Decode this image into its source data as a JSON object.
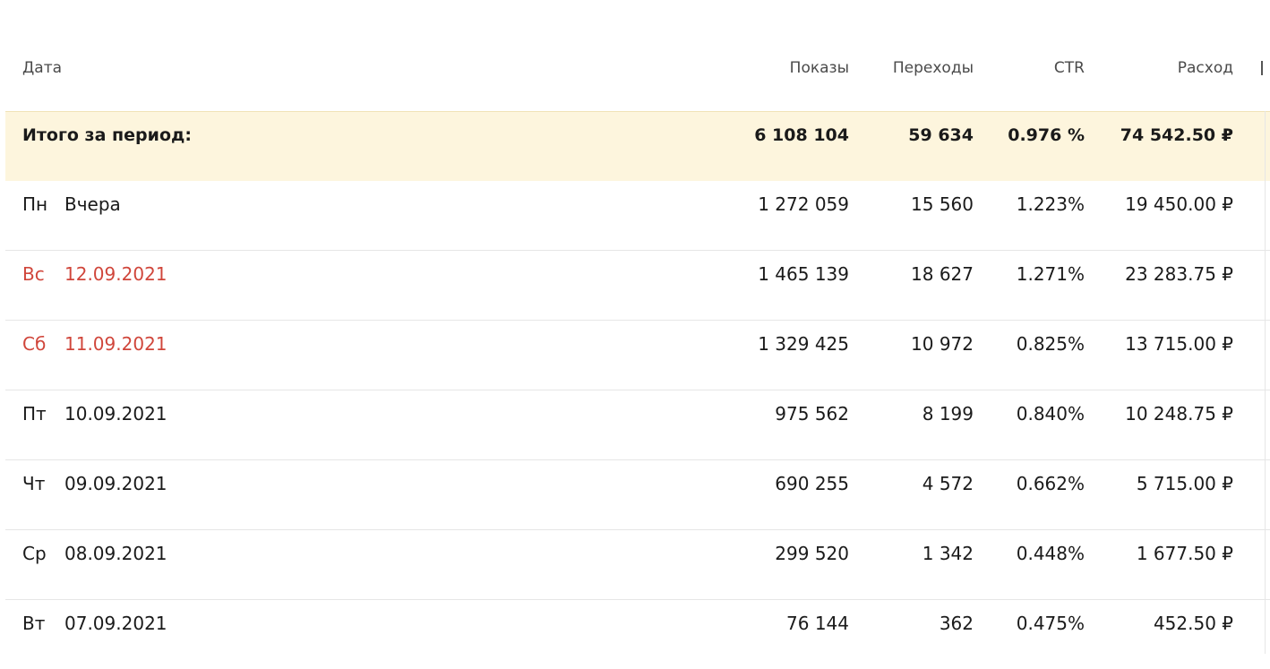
{
  "columns": {
    "date": "Дата",
    "shows": "Показы",
    "clicks": "Переходы",
    "ctr": "CTR",
    "cost": "Расход"
  },
  "total": {
    "label": "Итого за период:",
    "shows": "6 108 104",
    "clicks": "59 634",
    "ctr": "0.976 %",
    "cost": "74 542.50 ₽"
  },
  "rows": [
    {
      "dow": "Пн",
      "date": "Вчера",
      "shows": "1 272 059",
      "clicks": "15 560",
      "ctr": "1.223%",
      "cost": "19 450.00 ₽",
      "weekend": false
    },
    {
      "dow": "Вс",
      "date": "12.09.2021",
      "shows": "1 465 139",
      "clicks": "18 627",
      "ctr": "1.271%",
      "cost": "23 283.75 ₽",
      "weekend": true
    },
    {
      "dow": "Сб",
      "date": "11.09.2021",
      "shows": "1 329 425",
      "clicks": "10 972",
      "ctr": "0.825%",
      "cost": "13 715.00 ₽",
      "weekend": true
    },
    {
      "dow": "Пт",
      "date": "10.09.2021",
      "shows": "975 562",
      "clicks": "8 199",
      "ctr": "0.840%",
      "cost": "10 248.75 ₽",
      "weekend": false
    },
    {
      "dow": "Чт",
      "date": "09.09.2021",
      "shows": "690 255",
      "clicks": "4 572",
      "ctr": "0.662%",
      "cost": "5 715.00 ₽",
      "weekend": false
    },
    {
      "dow": "Ср",
      "date": "08.09.2021",
      "shows": "299 520",
      "clicks": "1 342",
      "ctr": "0.448%",
      "cost": "1 677.50 ₽",
      "weekend": false
    },
    {
      "dow": "Вт",
      "date": "07.09.2021",
      "shows": "76 144",
      "clicks": "362",
      "ctr": "0.475%",
      "cost": "452.50 ₽",
      "weekend": false
    }
  ],
  "colors": {
    "weekend": "#d0463b",
    "total_bg": "#fdf5dd"
  }
}
